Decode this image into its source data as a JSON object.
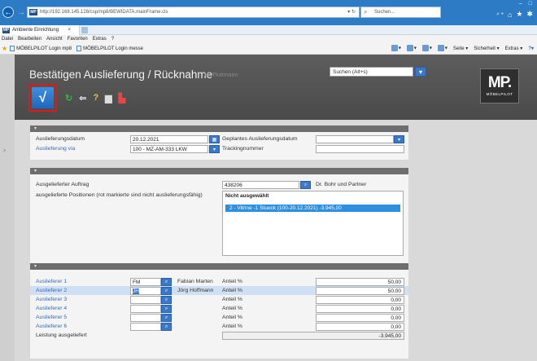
{
  "browser": {
    "url": "http://192.168.145.128/csp/mp8/BEWIDATA.mainFrame.cls",
    "search_placeholder": "Suchen...",
    "tab_title": "Ambiente Einrichtung",
    "menu": [
      "Datei",
      "Bearbeiten",
      "Ansicht",
      "Favoriten",
      "Extras",
      "?"
    ],
    "favorites": [
      "MÖBELPILOT Login mp8",
      "MÖBELPILOT Login messe"
    ],
    "commands": [
      "Seite ▾",
      "Sicherheit ▾",
      "Extras ▾"
    ]
  },
  "app": {
    "title": "Bestätigen Auslieferung / Rücknahme",
    "user": "Uli Flottmann",
    "search_placeholder": "Suchen (Alt+s)",
    "logo_text": "MP.",
    "logo_sub": "MÖBELPILOT"
  },
  "delivery": {
    "date_label": "Auslieferungsdatum",
    "date_value": "20.12.2021",
    "via_label": "Auslieferung via",
    "via_value": "100 - MZ-AM-333 LKW",
    "planned_label": "Geplantes Auslieferungsdatum",
    "planned_value": "",
    "tracking_label": "Trackingnummer",
    "tracking_value": ""
  },
  "order": {
    "label": "Ausgelieferter Auftrag",
    "number": "438206",
    "customer": "Dr. Bohr und Partner",
    "positions_label": "ausgelieferte Positionen (rot markierte sind nicht auslieferungsfähig)",
    "list_header": "Nicht ausgewählt",
    "list_selected": "2 - Vitrine -1 Stueck (100-20.12.2021) -3.945,00"
  },
  "deliverers": {
    "rows": [
      {
        "label": "Auslieferer 1",
        "code": "FM",
        "name": "Fabian Marten",
        "share_label": "Anteil %",
        "share": "50,00"
      },
      {
        "label": "Auslieferer 2",
        "code": "JH",
        "name": "Jörg Hoffmann",
        "share_label": "Anteil %",
        "share": "50,00"
      },
      {
        "label": "Auslieferer 3",
        "code": "",
        "name": "",
        "share_label": "Anteil %",
        "share": "0,00"
      },
      {
        "label": "Auslieferer 4",
        "code": "",
        "name": "",
        "share_label": "Anteil %",
        "share": "0,00"
      },
      {
        "label": "Auslieferer 5",
        "code": "",
        "name": "",
        "share_label": "Anteil %",
        "share": "0,00"
      },
      {
        "label": "Auslieferer 6",
        "code": "",
        "name": "",
        "share_label": "Anteil %",
        "share": "0,00"
      }
    ],
    "performance_label": "Leistung ausgeliefert",
    "performance_currency": "€",
    "performance_value": "-3.945,00"
  }
}
